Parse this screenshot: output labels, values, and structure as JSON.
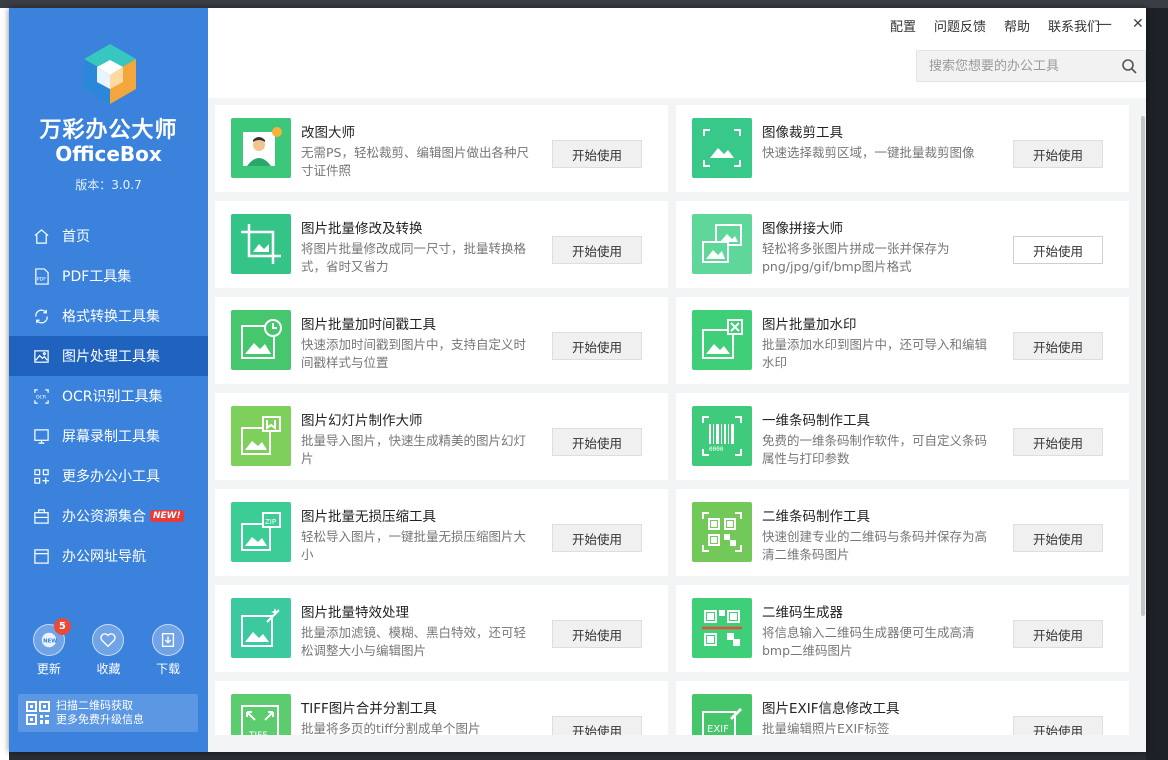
{
  "app": {
    "title": "万彩办公大师",
    "subtitle": "OfficeBox",
    "version": "版本：3.0.7"
  },
  "header": {
    "links": [
      "配置",
      "问题反馈",
      "帮助",
      "联系我们"
    ],
    "minimize": "—",
    "close": "✕",
    "search_placeholder": "搜索您想要的办公工具"
  },
  "nav": [
    {
      "label": "首页",
      "icon": "home-icon"
    },
    {
      "label": "PDF工具集",
      "icon": "pdf-icon"
    },
    {
      "label": "格式转换工具集",
      "icon": "convert-icon"
    },
    {
      "label": "图片处理工具集",
      "icon": "image-icon",
      "active": true
    },
    {
      "label": "OCR识别工具集",
      "icon": "ocr-icon"
    },
    {
      "label": "屏幕录制工具集",
      "icon": "screen-icon"
    },
    {
      "label": "更多办公小工具",
      "icon": "apps-icon"
    },
    {
      "label": "办公资源集合",
      "icon": "briefcase-icon",
      "badge": "NEW!"
    },
    {
      "label": "办公网址导航",
      "icon": "browser-icon"
    }
  ],
  "quick": [
    {
      "label": "更新",
      "icon": "update-icon",
      "badge": "5"
    },
    {
      "label": "收藏",
      "icon": "heart-icon"
    },
    {
      "label": "下载",
      "icon": "download-icon"
    }
  ],
  "qr_promo": {
    "line1": "扫描二维码获取",
    "line2": "更多免费升级信息"
  },
  "button_label": "开始使用",
  "tools": [
    {
      "title": "改图大师",
      "desc": "无需PS，轻松裁剪、编辑图片做出各种尺寸证件照",
      "icon": "portrait-icon"
    },
    {
      "title": "图像裁剪工具",
      "desc": "快速选择裁剪区域，一键批量裁剪图像",
      "icon": "crop-image-icon"
    },
    {
      "title": "图片批量修改及转换",
      "desc": "将图片批量修改成同一尺寸，批量转换格式，省时又省力",
      "icon": "resize-icon"
    },
    {
      "title": "图像拼接大师",
      "desc": "轻松将多张图片拼成一张并保存为png/jpg/gif/bmp图片格式",
      "icon": "stitch-icon"
    },
    {
      "title": "图片批量加时间戳工具",
      "desc": "快速添加时间戳到图片中，支持自定义时间戳样式与位置",
      "icon": "timestamp-icon"
    },
    {
      "title": "图片批量加水印",
      "desc": "批量添加水印到图片中，还可导入和编辑水印",
      "icon": "watermark-icon"
    },
    {
      "title": "图片幻灯片制作大师",
      "desc": "批量导入图片，快速生成精美的图片幻灯片",
      "icon": "slideshow-icon"
    },
    {
      "title": "一维条码制作工具",
      "desc": "免费的一维条码制作软件，可自定义条码属性与打印参数",
      "icon": "barcode-icon"
    },
    {
      "title": "图片批量无损压缩工具",
      "desc": "轻松导入图片，一键批量无损压缩图片大小",
      "icon": "zip-icon"
    },
    {
      "title": "二维条码制作工具",
      "desc": "快速创建专业的二维码与条码并保存为高清二维条码图片",
      "icon": "qrcode-maker-icon"
    },
    {
      "title": "图片批量特效处理",
      "desc": "批量添加滤镜、模糊、黑白特效，还可轻松调整大小与编辑图片",
      "icon": "effects-icon"
    },
    {
      "title": "二维码生成器",
      "desc": "将信息输入二维码生成器便可生成高清bmp二维码图片",
      "icon": "qrcode-gen-icon"
    },
    {
      "title": "TIFF图片合并分割工具",
      "desc": "批量将多页的tiff分割成单个图片",
      "icon": "tiff-icon"
    },
    {
      "title": "图片EXIF信息修改工具",
      "desc": "批量编辑照片EXIF标签",
      "icon": "exif-icon"
    }
  ],
  "colors": {
    "sidebar": "#3b82dd",
    "sidebar_active": "#1f63bf",
    "icon_green": "#3fcf78"
  }
}
